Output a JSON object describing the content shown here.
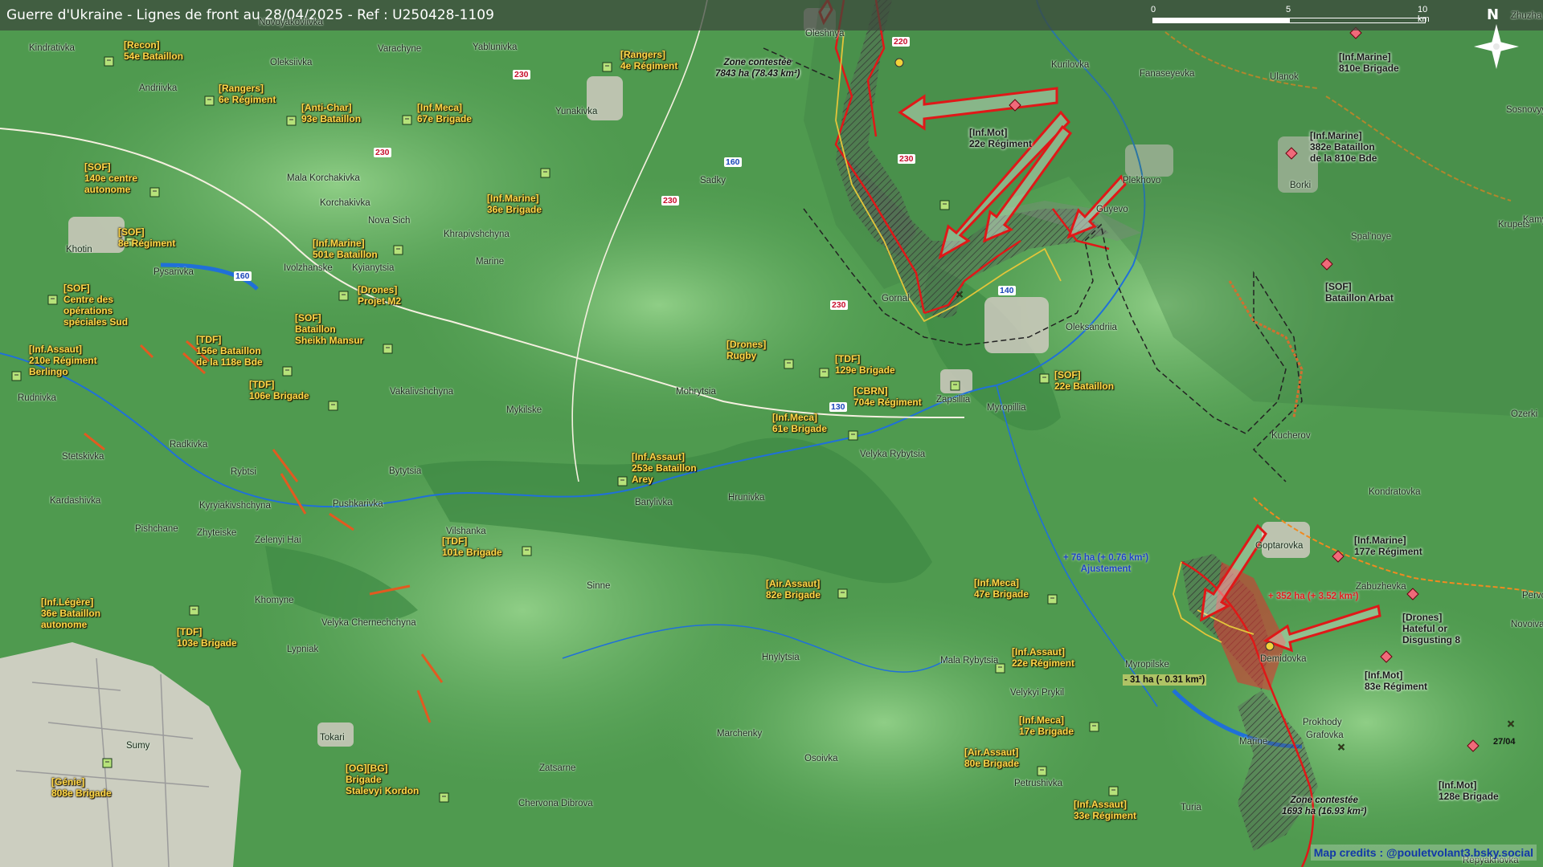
{
  "title": "Guerre d'Ukraine - Lignes de front au 28/04/2025 - Ref : U250428-1109",
  "scale": {
    "labels": [
      "0",
      "5",
      "10 km"
    ]
  },
  "compass": "N",
  "credits": "Map credits : @pouletvolant3.bsky.social",
  "date_tag": "27/04",
  "colors": {
    "russian_arrow": "#e01818",
    "front_line": "#e01818",
    "contested_zone": "#6b6b6b",
    "ukrainian_units": "#ffd84a"
  },
  "towns": [
    "Kindrativka",
    "Novoyakovlivka",
    "Varachyne",
    "Yablunivka",
    "Loknia",
    "Oleshnya",
    "Kurilovka",
    "Fanaseyevka",
    "Ulanok",
    "Andriivka",
    "Oleksiivka",
    "Yunakivka",
    "Mala Korchakivka",
    "Korchakivka",
    "Sadky",
    "Plekhovo",
    "Guyevo",
    "Borki",
    "Spal'noye",
    "Nova Sich",
    "Khrapivshchyna",
    "Khotin",
    "Pysarivka",
    "Ivolzhanske",
    "Kyianytsia",
    "Marine",
    "Gornal",
    "Oleksandriia",
    "Mohrytsia",
    "Zapsillia",
    "Myropillia",
    "Rudnivka",
    "Vakalivshchyna",
    "Mykilske",
    "Radkivka",
    "Velyka Rybytsia",
    "Kucherov",
    "Stetskivka",
    "Rybtsi",
    "Bytytsia",
    "Kardashivka",
    "Kyryiakivshchyna",
    "Pushkarivka",
    "Barylivka",
    "Hrunivka",
    "Kondratovka",
    "Pishchane",
    "Zhyteiske",
    "Zelenyi Hai",
    "Vilshanka",
    "Goptarovka",
    "Zabuzhevka",
    "Sinne",
    "Khomyne",
    "Velyka Chernechchyna",
    "Lypniak",
    "Hnylytsia",
    "Mala Rybytsia",
    "Myropilske",
    "Demidovka",
    "Novoivanivka",
    "Velykyi Prykil",
    "Prokhody",
    "Marchenky",
    "Sumy",
    "Tokari",
    "Grafovka",
    "Marine",
    "Zatsarne",
    "Osoivka",
    "Petrushivka",
    "Chervona Dibrova",
    "Turia",
    "Kamy",
    "Krupets",
    "Sosnovyy Bor",
    "Ozerki",
    "Pervomaisk",
    "Repyakhovka",
    "Zhuzha"
  ],
  "roads": [
    {
      "label": "230",
      "style": "red"
    },
    {
      "label": "220",
      "style": "red"
    },
    {
      "label": "230",
      "style": "red"
    },
    {
      "label": "160",
      "style": "blue"
    },
    {
      "label": "230",
      "style": "red"
    },
    {
      "label": "230",
      "style": "red"
    },
    {
      "label": "160",
      "style": "blue"
    },
    {
      "label": "140",
      "style": "blue"
    },
    {
      "label": "230",
      "style": "red"
    },
    {
      "label": "130",
      "style": "blue"
    }
  ],
  "ukrainian_units": [
    {
      "lines": [
        "[Recon]",
        "54e Bataillon"
      ]
    },
    {
      "lines": [
        "[Rangers]",
        "6e Régiment"
      ]
    },
    {
      "lines": [
        "[Anti-Char]",
        "93e Bataillon"
      ]
    },
    {
      "lines": [
        "[Inf.Meca]",
        "67e Brigade"
      ]
    },
    {
      "lines": [
        "[Rangers]",
        "4e Régiment"
      ]
    },
    {
      "lines": [
        "[SOF]",
        "140e centre",
        "autonome"
      ]
    },
    {
      "lines": [
        "[Inf.Marine]",
        "36e Brigade"
      ]
    },
    {
      "lines": [
        "[SOF]",
        "8e Régiment"
      ]
    },
    {
      "lines": [
        "[Inf.Marine]",
        "501e Bataillon"
      ]
    },
    {
      "lines": [
        "[SOF]",
        "Centre des",
        "opérations",
        "spéciales Sud"
      ]
    },
    {
      "lines": [
        "[Drones]",
        "Projet M2"
      ]
    },
    {
      "lines": [
        "[SOF]",
        "Bataillon",
        "Sheikh Mansur"
      ]
    },
    {
      "lines": [
        "[Inf.Assaut]",
        "210e Régiment",
        "Berlingo"
      ]
    },
    {
      "lines": [
        "[TDF]",
        "156e Bataillon",
        "de la 118e Bde"
      ]
    },
    {
      "lines": [
        "[TDF]",
        "106e Brigade"
      ]
    },
    {
      "lines": [
        "[Drones]",
        "Rugby"
      ]
    },
    {
      "lines": [
        "[TDF]",
        "129e Brigade"
      ]
    },
    {
      "lines": [
        "[CBRN]",
        "704e Régiment"
      ]
    },
    {
      "lines": [
        "[SOF]",
        "22e Bataillon"
      ]
    },
    {
      "lines": [
        "[Inf.Meca]",
        "61e Brigade"
      ]
    },
    {
      "lines": [
        "[Inf.Assaut]",
        "253e Bataillon",
        "Arey"
      ]
    },
    {
      "lines": [
        "[TDF]",
        "101e Brigade"
      ]
    },
    {
      "lines": [
        "[Inf.Légère]",
        "36e Bataillon",
        "autonome"
      ]
    },
    {
      "lines": [
        "[TDF]",
        "103e Brigade"
      ]
    },
    {
      "lines": [
        "[Air.Assaut]",
        "82e Brigade"
      ]
    },
    {
      "lines": [
        "[Inf.Meca]",
        "47e Brigade"
      ]
    },
    {
      "lines": [
        "[Inf.Assaut]",
        "22e Régiment"
      ]
    },
    {
      "lines": [
        "[Inf.Meca]",
        "17e Brigade"
      ]
    },
    {
      "lines": [
        "[Air.Assaut]",
        "80e Brigade"
      ]
    },
    {
      "lines": [
        "[Inf.Assaut]",
        "33e Régiment"
      ]
    },
    {
      "lines": [
        "[OG][BG]",
        "Brigade",
        "Stalevyi Kordon"
      ]
    },
    {
      "lines": [
        "[Génie]",
        "808e Brigade"
      ]
    }
  ],
  "russian_units": [
    {
      "lines": [
        "[Inf.Marine]",
        "810e Brigade"
      ]
    },
    {
      "lines": [
        "[Inf.Mot]",
        "22e Régiment"
      ]
    },
    {
      "lines": [
        "[Inf.Marine]",
        "382e Bataillon",
        "de la 810e Bde"
      ]
    },
    {
      "lines": [
        "[SOF]",
        "Bataillon Arbat"
      ]
    },
    {
      "lines": [
        "[Inf.Marine]",
        "177e Régiment"
      ]
    },
    {
      "lines": [
        "[Drones]",
        "Hateful or",
        "Disgusting 8"
      ]
    },
    {
      "lines": [
        "[Inf.Mot]",
        "83e Régiment"
      ]
    },
    {
      "lines": [
        "[Inf.Mot]",
        "128e Brigade"
      ]
    }
  ],
  "zones": [
    {
      "lines": [
        "Zone contestée",
        "7843 ha (78.43 km²)"
      ]
    },
    {
      "lines": [
        "Zone contestée",
        "1693 ha (16.93 km²)"
      ]
    }
  ],
  "changes": [
    {
      "lines": [
        "+ 76 ha (+ 0.76 km²)",
        "Ajustement"
      ],
      "style": "blue"
    },
    {
      "lines": [
        "+ 352 ha (+ 3.52 km²)"
      ],
      "style": "red"
    },
    {
      "lines": [
        "- 31 ha (- 0.31 km²)"
      ],
      "style": "dark"
    }
  ]
}
